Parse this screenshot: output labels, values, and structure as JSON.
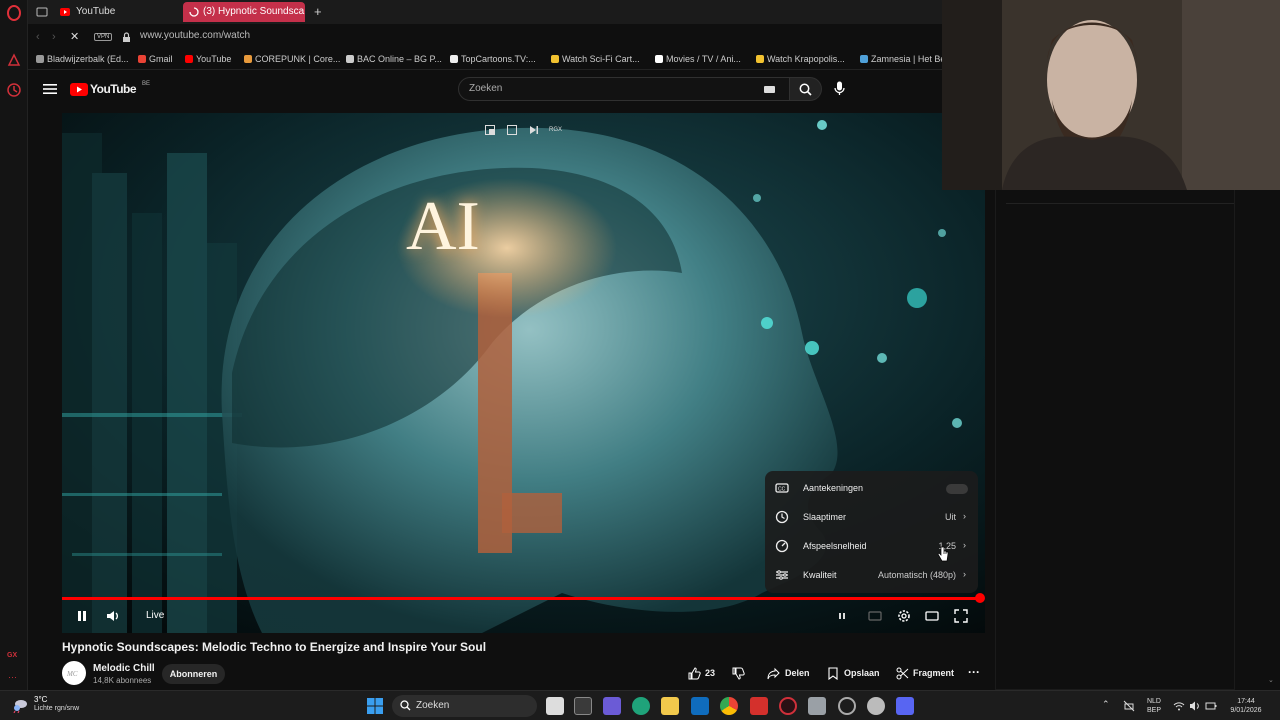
{
  "browser": {
    "tabs": [
      {
        "label": "YouTube"
      },
      {
        "label": "(3) Hypnotic Soundsca"
      }
    ],
    "vpn_label": "VPN",
    "url": "www.youtube.com/watch",
    "bookmarks": [
      {
        "label": "Bladwijzerbalk (Ed...",
        "color": "#999999"
      },
      {
        "label": "Gmail",
        "color": "#ea4335"
      },
      {
        "label": "YouTube",
        "color": "#ff0000"
      },
      {
        "label": "COREPUNK | Core...",
        "color": "#e89a3c"
      },
      {
        "label": "BAC Online – BG P...",
        "color": "#cccccc"
      },
      {
        "label": "TopCartoons.TV:...",
        "color": "#eeeeee"
      },
      {
        "label": "Watch Sci-Fi Cart...",
        "color": "#f2c230"
      },
      {
        "label": "Movies / TV / Ani...",
        "color": "#ffffff"
      },
      {
        "label": "Watch Krapopolis...",
        "color": "#f2c230"
      },
      {
        "label": "Zamnesia | Het Be",
        "color": "#4fa0d8"
      }
    ]
  },
  "youtube": {
    "logo_text": "YouTube",
    "logo_region": "BE",
    "search_placeholder": "Zoeken"
  },
  "player": {
    "overlay_badge": "RGX",
    "live_label": "Live",
    "progress": 1.0,
    "settings_menu": [
      {
        "icon": "captions-icon",
        "label": "Aantekeningen",
        "value": ""
      },
      {
        "icon": "sleep-timer-icon",
        "label": "Slaaptimer",
        "value": "Uit"
      },
      {
        "icon": "playback-speed-icon",
        "label": "Afspeelsnelheid",
        "value": "1,25"
      },
      {
        "icon": "quality-icon",
        "label": "Kwaliteit",
        "value": "Automatisch (480p)"
      }
    ],
    "video_text": "AI"
  },
  "video": {
    "title": "Hypnotic Soundscapes: Melodic Techno to Energize and Inspire Your Soul",
    "channel": "Melodic Chill",
    "subscribers": "14,8K abonnees",
    "subscribe_label": "Abonneren",
    "likes": "23",
    "share_label": "Delen",
    "save_label": "Opslaan",
    "clip_label": "Fragment"
  },
  "sidebar": {
    "gx_label": "GX"
  },
  "taskbar": {
    "weather_temp": "3°C",
    "weather_desc": "Lichte rgn/snw",
    "search_label": "Zoeken",
    "lang_line1": "NLD",
    "lang_line2": "BEP",
    "time": "17:44",
    "date": "9/01/2026"
  },
  "colors": {
    "accent": "#ff0000",
    "opera_red": "#c4304a",
    "background": "#0f0f0f"
  }
}
